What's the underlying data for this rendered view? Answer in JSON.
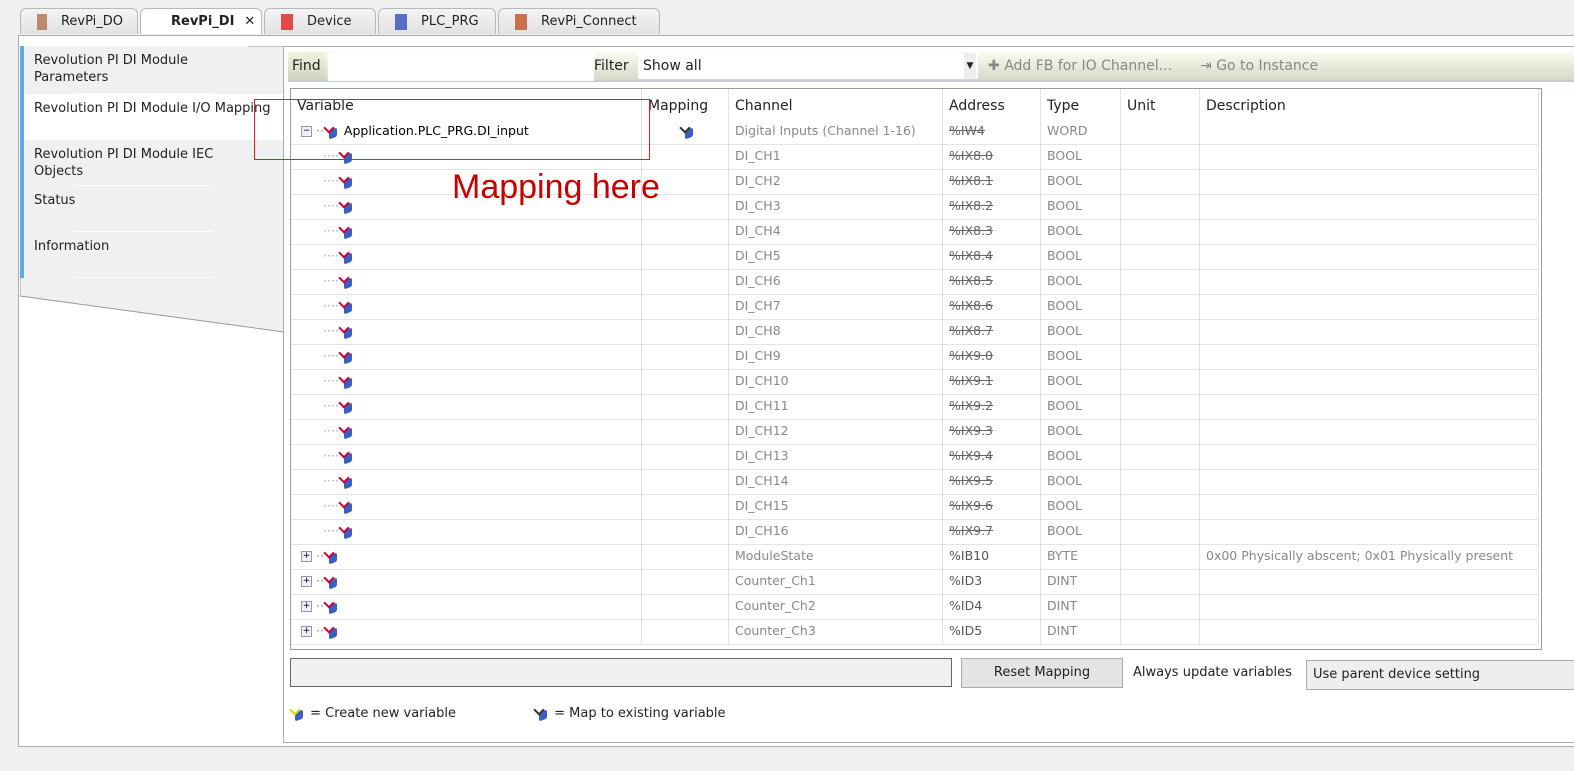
{
  "tabs": [
    {
      "label": "RevPi_DO",
      "icon": "module-icon",
      "active": false
    },
    {
      "label": "RevPi_DI",
      "icon": "module-icon",
      "active": true
    },
    {
      "label": "Device",
      "icon": "device-icon",
      "active": false
    },
    {
      "label": "PLC_PRG",
      "icon": "program-icon",
      "active": false
    },
    {
      "label": "RevPi_Connect",
      "icon": "revpi-connect-icon",
      "active": false
    }
  ],
  "tab_close": "✕",
  "sidebar": {
    "items": [
      {
        "label": "Revolution PI DI Module Parameters"
      },
      {
        "label": "Revolution PI DI Module I/O Mapping",
        "selected": true
      },
      {
        "label": "Revolution PI DI Module IEC Objects"
      },
      {
        "label": "Status"
      },
      {
        "label": "Information"
      }
    ]
  },
  "toolbar": {
    "find_label": "Find",
    "find_value": "",
    "filter_label": "Filter",
    "filter_value": "Show all",
    "add_fb": "Add FB for IO Channel...",
    "go_to_instance": "Go to Instance"
  },
  "table": {
    "columns": [
      "Variable",
      "Mapping",
      "Channel",
      "Address",
      "Type",
      "Unit",
      "Description"
    ],
    "rows": [
      {
        "level": 0,
        "expander": "−",
        "variable": "Application.PLC_PRG.DI_input",
        "mapped": true,
        "channel": "Digital Inputs (Channel 1-16)",
        "address": "%IW4",
        "strike": true,
        "type": "WORD",
        "unit": "",
        "description": ""
      },
      {
        "level": 1,
        "variable": "",
        "channel": "DI_CH1",
        "address": "%IX8.0",
        "strike": true,
        "type": "BOOL"
      },
      {
        "level": 1,
        "variable": "",
        "channel": "DI_CH2",
        "address": "%IX8.1",
        "strike": true,
        "type": "BOOL"
      },
      {
        "level": 1,
        "variable": "",
        "channel": "DI_CH3",
        "address": "%IX8.2",
        "strike": true,
        "type": "BOOL"
      },
      {
        "level": 1,
        "variable": "",
        "channel": "DI_CH4",
        "address": "%IX8.3",
        "strike": true,
        "type": "BOOL"
      },
      {
        "level": 1,
        "variable": "",
        "channel": "DI_CH5",
        "address": "%IX8.4",
        "strike": true,
        "type": "BOOL"
      },
      {
        "level": 1,
        "variable": "",
        "channel": "DI_CH6",
        "address": "%IX8.5",
        "strike": true,
        "type": "BOOL"
      },
      {
        "level": 1,
        "variable": "",
        "channel": "DI_CH7",
        "address": "%IX8.6",
        "strike": true,
        "type": "BOOL"
      },
      {
        "level": 1,
        "variable": "",
        "channel": "DI_CH8",
        "address": "%IX8.7",
        "strike": true,
        "type": "BOOL"
      },
      {
        "level": 1,
        "variable": "",
        "channel": "DI_CH9",
        "address": "%IX9.0",
        "strike": true,
        "type": "BOOL"
      },
      {
        "level": 1,
        "variable": "",
        "channel": "DI_CH10",
        "address": "%IX9.1",
        "strike": true,
        "type": "BOOL"
      },
      {
        "level": 1,
        "variable": "",
        "channel": "DI_CH11",
        "address": "%IX9.2",
        "strike": true,
        "type": "BOOL"
      },
      {
        "level": 1,
        "variable": "",
        "channel": "DI_CH12",
        "address": "%IX9.3",
        "strike": true,
        "type": "BOOL"
      },
      {
        "level": 1,
        "variable": "",
        "channel": "DI_CH13",
        "address": "%IX9.4",
        "strike": true,
        "type": "BOOL"
      },
      {
        "level": 1,
        "variable": "",
        "channel": "DI_CH14",
        "address": "%IX9.5",
        "strike": true,
        "type": "BOOL"
      },
      {
        "level": 1,
        "variable": "",
        "channel": "DI_CH15",
        "address": "%IX9.6",
        "strike": true,
        "type": "BOOL"
      },
      {
        "level": 1,
        "variable": "",
        "channel": "DI_CH16",
        "address": "%IX9.7",
        "strike": true,
        "type": "BOOL"
      },
      {
        "level": 0,
        "expander": "+",
        "variable": "",
        "channel": "ModuleState",
        "address": "%IB10",
        "strike": false,
        "type": "BYTE",
        "description": "0x00 Physically abscent; 0x01 Physically present"
      },
      {
        "level": 0,
        "expander": "+",
        "variable": "",
        "channel": "Counter_Ch1",
        "address": "%ID3",
        "strike": false,
        "type": "DINT"
      },
      {
        "level": 0,
        "expander": "+",
        "variable": "",
        "channel": "Counter_Ch2",
        "address": "%ID4",
        "strike": false,
        "type": "DINT"
      },
      {
        "level": 0,
        "expander": "+",
        "variable": "",
        "channel": "Counter_Ch3",
        "address": "%ID5",
        "strike": false,
        "type": "DINT"
      }
    ]
  },
  "bottom": {
    "reset_mapping": "Reset Mapping",
    "always_update_label": "Always update variables",
    "always_update_value": "Use parent device setting"
  },
  "legend": {
    "create_new": "= Create new variable",
    "map_existing": "= Map to existing variable"
  },
  "annotation": {
    "text": "Mapping here",
    "color": "#c80000"
  }
}
